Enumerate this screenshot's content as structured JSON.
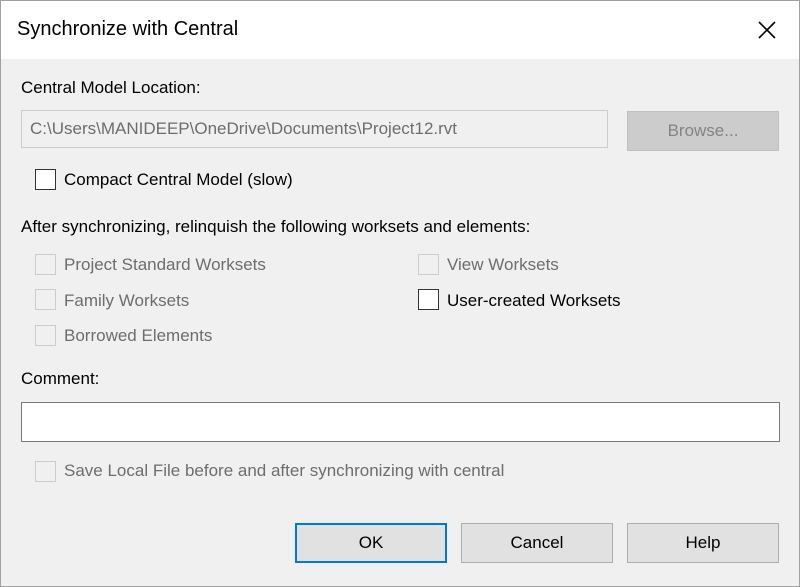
{
  "window": {
    "title": "Synchronize with Central",
    "close_icon": "close-icon"
  },
  "central": {
    "label": "Central Model Location:",
    "path": "C:\\Users\\MANIDEEP\\OneDrive\\Documents\\Project12.rvt",
    "browse_label": "Browse..."
  },
  "compact": {
    "label": "Compact Central Model (slow)",
    "checked": false
  },
  "relinquish": {
    "heading": "After synchronizing, relinquish the following worksets and elements:",
    "project_standard": "Project Standard Worksets",
    "family": "Family Worksets",
    "borrowed": "Borrowed Elements",
    "view": "View Worksets",
    "user_created": "User-created Worksets"
  },
  "comment": {
    "label": "Comment:",
    "value": ""
  },
  "save_local": {
    "label": "Save Local File before and after synchronizing with central"
  },
  "buttons": {
    "ok": "OK",
    "cancel": "Cancel",
    "help": "Help"
  },
  "colors": {
    "default_button_border": "#0078d7",
    "dialog_background": "#f0f0f0",
    "disabled_text": "#6d6d6d"
  }
}
